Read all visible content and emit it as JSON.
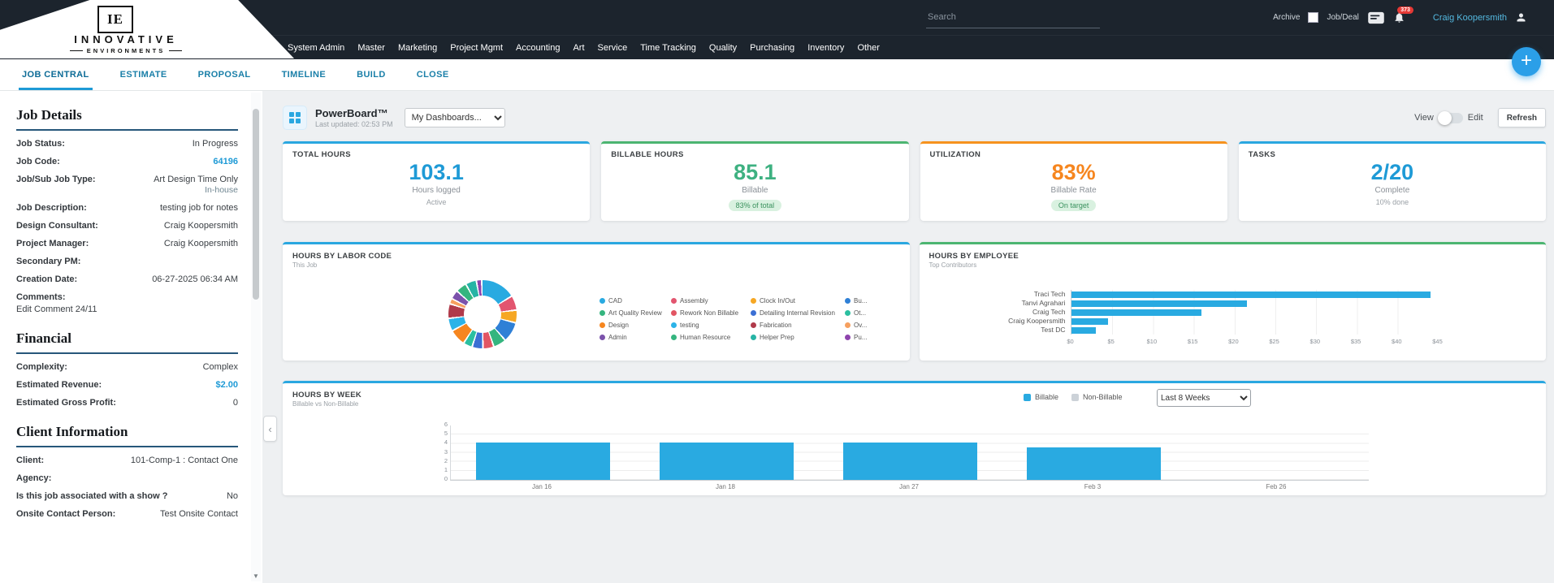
{
  "header": {
    "logo": {
      "monogram": "IE",
      "line1": "INNOVATIVE",
      "line2": "ENVIRONMENTS"
    },
    "search_placeholder": "Search",
    "archive_label": "Archive",
    "job_deal_label": "Job/Deal",
    "notification_count": "373",
    "username": "Craig Koopersmith"
  },
  "nav": {
    "items": [
      "System Admin",
      "Master",
      "Marketing",
      "Project Mgmt",
      "Accounting",
      "Art",
      "Service",
      "Time Tracking",
      "Quality",
      "Purchasing",
      "Inventory",
      "Other"
    ]
  },
  "tabs": {
    "items": [
      "JOB CENTRAL",
      "ESTIMATE",
      "PROPOSAL",
      "TIMELINE",
      "BUILD",
      "CLOSE"
    ],
    "add_button": "+"
  },
  "sidebar": {
    "job_details": {
      "title": "Job Details",
      "job_status_label": "Job Status:",
      "job_status": "In Progress",
      "job_code_label": "Job Code:",
      "job_code": "64196",
      "job_type_label": "Job/Sub Job Type:",
      "job_type": "Art Design Time Only",
      "job_type_sub": "In-house",
      "job_description_label": "Job Description:",
      "job_description": "testing job for notes",
      "design_consultant_label": "Design Consultant:",
      "design_consultant": "Craig Koopersmith",
      "project_manager_label": "Project Manager:",
      "project_manager": "Craig Koopersmith",
      "secondary_pm_label": "Secondary PM:",
      "secondary_pm": "",
      "creation_date_label": "Creation Date:",
      "creation_date": "06-27-2025 06:34 AM",
      "comments_label": "Comments:",
      "comments": "Edit Comment 24/11"
    },
    "financial": {
      "title": "Financial",
      "complexity_label": "Complexity:",
      "complexity": "Complex",
      "estimated_revenue_label": "Estimated Revenue:",
      "estimated_revenue": "$2.00",
      "estimated_gross_profit_label": "Estimated Gross Profit:",
      "estimated_gross_profit": "0"
    },
    "client_information": {
      "title": "Client Information",
      "client_label": "Client:",
      "client": "101-Comp-1 : Contact One",
      "agency_label": "Agency:",
      "agency": "",
      "show_label": "Is this job associated with a show ?",
      "show": "No",
      "onsite_label": "Onsite Contact Person:",
      "onsite": "Test Onsite Contact"
    }
  },
  "dashboard": {
    "title": "PowerBoard™",
    "last_updated": "Last updated: 02:53 PM",
    "dashboard_select": "My Dashboards...",
    "view_label": "View",
    "edit_label": "Edit",
    "refresh_label": "Refresh"
  },
  "kpis": [
    {
      "title": "TOTAL HOURS",
      "value": "103.1",
      "label": "Hours logged",
      "sub": "Active",
      "accent": "#2aa7e0",
      "value_color": "#1e9ad6"
    },
    {
      "title": "BILLABLE HOURS",
      "value": "85.1",
      "label": "Billable",
      "badge": "83% of total",
      "accent": "#4cb571",
      "value_color": "#3eb181"
    },
    {
      "title": "UTILIZATION",
      "value": "83%",
      "label": "Billable Rate",
      "badge": "On target",
      "accent": "#f6921e",
      "value_color": "#f6861f"
    },
    {
      "title": "TASKS",
      "value": "2/20",
      "label": "Complete",
      "sub": "10% done",
      "accent": "#2aa7e0",
      "value_color": "#1e9ad6"
    }
  ],
  "chart_data": [
    {
      "type": "pie",
      "title": "HOURS BY LABOR CODE",
      "subtitle": "This Job",
      "legend_position": "right",
      "labels": [
        "CAD",
        "Assembly",
        "Clock In/Out",
        "Bu...",
        "Art Quality Review",
        "Rework Non Billable",
        "Detailing Internal Revision",
        "Ot...",
        "Design",
        "testing",
        "Fabrication",
        "Ov...",
        "Admin",
        "Human Resource",
        "Helper Prep",
        "Pu..."
      ],
      "values": [
        18,
        7,
        6,
        10,
        6,
        5,
        5,
        4,
        8,
        6,
        7,
        2,
        4,
        5,
        5,
        2
      ],
      "colors": [
        "#29aae1",
        "#e2556f",
        "#f6a723",
        "#2f80d6",
        "#35b57f",
        "#e25563",
        "#3b6fd4",
        "#2bbfa0",
        "#f6861f",
        "#2bb3e8",
        "#b03a4a",
        "#f6a05f",
        "#7b52ab",
        "#35b57f",
        "#27b4a5",
        "#8e44ad"
      ]
    },
    {
      "type": "bar-horizontal",
      "title": "HOURS BY EMPLOYEE",
      "subtitle": "Top Contributors",
      "categories": [
        "Traci Tech",
        "Tanvi Agrahari",
        "Craig Tech",
        "Craig Koopersmith",
        "Test DC"
      ],
      "values": [
        44,
        21.5,
        16,
        4.5,
        3
      ],
      "xlim": [
        0,
        45
      ],
      "x_ticks": [
        "$0",
        "$5",
        "$10",
        "$15",
        "$20",
        "$25",
        "$30",
        "$35",
        "$40",
        "$45"
      ],
      "bar_color": "#29aae1",
      "grid": true
    },
    {
      "type": "bar",
      "title": "HOURS BY WEEK",
      "subtitle": "Billable vs Non-Billable",
      "categories": [
        "Jan 16",
        "Jan 18",
        "Jan 27",
        "Feb 3",
        "Feb 26"
      ],
      "series": [
        {
          "name": "Billable",
          "color": "#29aae1",
          "values": [
            4.1,
            4.1,
            4.1,
            3.6,
            0
          ]
        },
        {
          "name": "Non-Billable",
          "color": "#ccd2d8",
          "values": [
            0,
            0,
            0,
            0,
            0
          ]
        }
      ],
      "ylim": [
        0,
        6
      ],
      "y_ticks": [
        0,
        1,
        2,
        3,
        4,
        5,
        6
      ],
      "filter_label": "Last 8 Weeks",
      "grid": true,
      "legend_position": "top-right"
    }
  ]
}
